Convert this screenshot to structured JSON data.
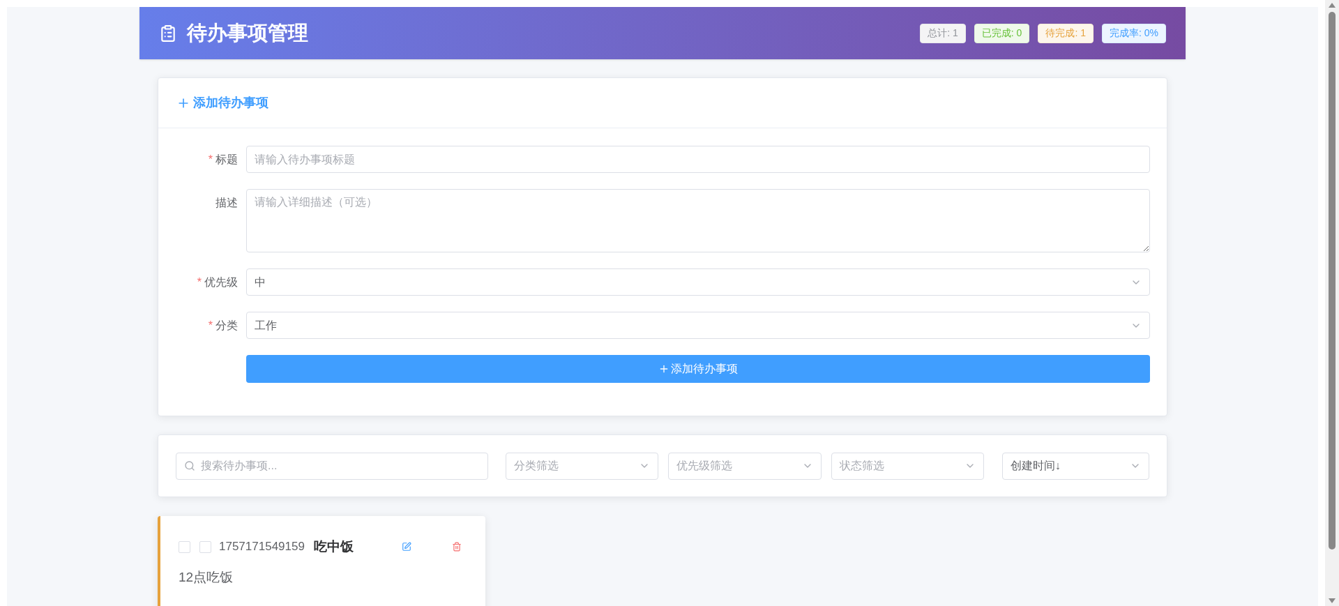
{
  "header": {
    "title": "待办事项管理",
    "stats": [
      {
        "label": "总计: 1",
        "kind": "total"
      },
      {
        "label": "已完成: 0",
        "kind": "done"
      },
      {
        "label": "待完成: 1",
        "kind": "pending"
      },
      {
        "label": "完成率: 0%",
        "kind": "rate"
      }
    ]
  },
  "form": {
    "heading": "添加待办事项",
    "required_mark": "*",
    "fields": [
      {
        "label": "标题",
        "required": true,
        "kind": "input",
        "placeholder": "请输入待办事项标题"
      },
      {
        "label": "描述",
        "required": false,
        "kind": "textarea",
        "placeholder": "请输入详细描述（可选）"
      },
      {
        "label": "优先级",
        "required": true,
        "kind": "select",
        "value": "中"
      },
      {
        "label": "分类",
        "required": true,
        "kind": "select",
        "value": "工作"
      }
    ],
    "submit": "添加待办事项"
  },
  "filters": {
    "search": {
      "placeholder": "搜索待办事项..."
    },
    "selects": [
      {
        "placeholder": "分类筛选"
      },
      {
        "placeholder": "优先级筛选"
      },
      {
        "placeholder": "状态筛选"
      },
      {
        "value": "创建时间↓"
      }
    ]
  },
  "todos": [
    {
      "id": "1757171549159",
      "title": "吃中饭",
      "description": "12点吃饭",
      "selected": false,
      "completed": false,
      "color": "#e6a23c"
    }
  ]
}
